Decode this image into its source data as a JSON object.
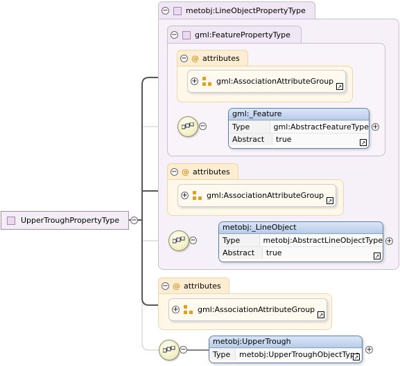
{
  "diagram": {
    "root": {
      "label": "UpperTroughPropertyType"
    },
    "line_object_type": {
      "label": "metobj:LineObjectPropertyType"
    },
    "feature_property_type": {
      "label": "gml:FeaturePropertyType"
    },
    "attributes": {
      "inner": {
        "label": "attributes",
        "group": "gml:AssociationAttributeGroup"
      },
      "middle": {
        "label": "attributes",
        "group": "gml:AssociationAttributeGroup"
      },
      "outer": {
        "label": "attributes",
        "group": "gml:AssociationAttributeGroup"
      }
    },
    "elements": {
      "feature": {
        "title": "gml:_Feature",
        "rows": [
          {
            "key": "Type",
            "value": "gml:AbstractFeatureType"
          },
          {
            "key": "Abstract",
            "value": "true"
          }
        ]
      },
      "line_object": {
        "title": "metobj:_LineObject",
        "rows": [
          {
            "key": "Type",
            "value": "metobj:AbstractLineObjectType"
          },
          {
            "key": "Abstract",
            "value": "true"
          }
        ]
      },
      "upper_trough": {
        "title": "metobj:UpperTrough",
        "rows": [
          {
            "key": "Type",
            "value": "metobj:UpperTroughObjectType"
          }
        ]
      }
    },
    "symbols": {
      "collapse": "−",
      "expand": "+",
      "link": "↗",
      "attribute": "@"
    }
  }
}
